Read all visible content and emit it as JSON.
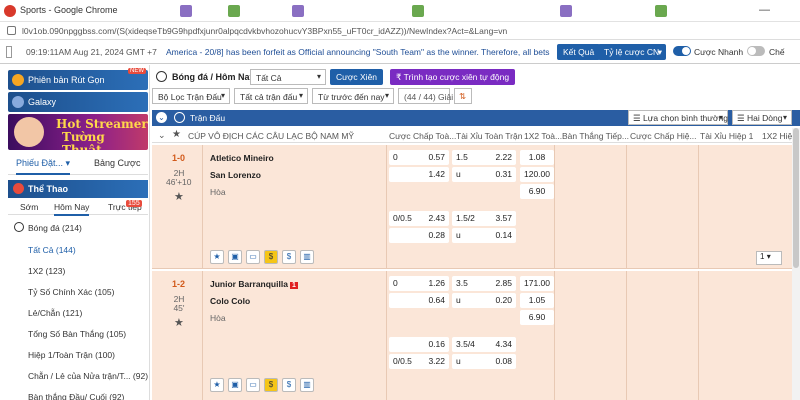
{
  "browser": {
    "title": "Sports - Google Chrome",
    "url": "l0v1ob.090npggbss.com/(S(xideqseTb9G9hpdfxjunr0alpqcdvkbvhozohucvY3BPxn55_uFT0cr_idAZZ))/NewIndex?Act=&Lang=vn",
    "minimize": "—"
  },
  "topbar": {
    "datetime": "09:19:11AM Aug 21, 2024 GMT +7",
    "ticker": "America - 20/8] has been forfeit as Official announcing \"South Team\" as the winner. Therefore, all bets",
    "results_label": "Kết Quả",
    "odds_label": "Tỷ lệ cược CN",
    "quick_bet_label": "Cược Nhanh",
    "che_label": "Chế"
  },
  "sidebar": {
    "banner1": "Phiên bản Rút Gọn",
    "banner1_badge": "NEW",
    "banner2": "Galaxy",
    "streamer_line1": "Hot Streamer",
    "streamer_line2": "Tường Thuật",
    "tab_slip": "Phiếu Đặt...",
    "tab_odds_table": "Bảng Cược",
    "sport_header": "Thể Thao",
    "time_tabs": [
      "Sớm",
      "Hôm Nay",
      "Trực tiếp"
    ],
    "live_badge": "155",
    "items": [
      "Bóng đá (214)",
      "Tất Cả (144)",
      "1X2 (123)",
      "Tỷ Số Chính Xác (105)",
      "Lẻ/Chẵn (121)",
      "Tổng Số Bàn Thắng (105)",
      "Hiệp 1/Toàn Trận (100)",
      "Chẵn / Lẻ của Nửa trận/T... (92)",
      "Bàn thắng Đầu/ Cuối (92)"
    ]
  },
  "main": {
    "sport_label": "Bóng đá / Hôm Nay",
    "filter_all": "Tất Cả",
    "parlay_label": "Cược Xiên",
    "auto_parlay_label": "Trình tạo cược xiên tự động",
    "league_filter": "Bộ Lọc Trận Đấu",
    "all_matches": "Tất cả trận đấu",
    "sort_label": "Từ trước đến nay",
    "count": "(44 / 44) Giải",
    "section_title": "Trận Đấu",
    "view_select": "Lựa chọn bình thường",
    "two_line": "Hai Dòng",
    "columns": [
      "CÚP VÔ ĐỊCH CÁC CÂU LẠC BỘ NAM MỸ",
      "Cược Chấp Toà...",
      "Tài Xỉu Toàn Trận",
      "1X2 Toà...",
      "Bàn Thắng Tiếp...",
      "Cược Chấp Hiệ...",
      "Tài Xỉu Hiệp 1",
      "1X2 Hiệ"
    ],
    "page_select": "1",
    "matches": [
      {
        "score": "1-0",
        "period": "2H",
        "minute": "46'+10",
        "home": "Atletico Mineiro",
        "away": "San Lorenzo",
        "draw": "Hòa",
        "rows": [
          {
            "hdp": "0",
            "hdp_home": "0.57",
            "ou": "1.5",
            "ou_over": "2.22",
            "x12": "1.08"
          },
          {
            "hdp": "",
            "hdp_home": "1.42",
            "ou": "u",
            "ou_over": "0.31",
            "x12": "120.00"
          },
          {
            "hdp": "",
            "hdp_home": "",
            "ou": "",
            "ou_over": "",
            "x12": "6.90"
          },
          {
            "hdp": "0/0.5",
            "hdp_home": "2.43",
            "ou": "1.5/2",
            "ou_over": "3.57",
            "x12": ""
          },
          {
            "hdp": "",
            "hdp_home": "0.28",
            "ou": "u",
            "ou_over": "0.14",
            "x12": ""
          }
        ]
      },
      {
        "score": "1-2",
        "period": "2H",
        "minute": "45'",
        "home": "Junior Barranquilla",
        "home_red_cards": "1",
        "away": "Colo Colo",
        "draw": "Hòa",
        "rows": [
          {
            "hdp": "0",
            "hdp_home": "1.26",
            "ou": "3.5",
            "ou_over": "2.85",
            "x12": "171.00"
          },
          {
            "hdp": "",
            "hdp_home": "0.64",
            "ou": "u",
            "ou_over": "0.20",
            "x12": "1.05"
          },
          {
            "hdp": "",
            "hdp_home": "",
            "ou": "",
            "ou_over": "",
            "x12": "6.90"
          },
          {
            "hdp": "",
            "hdp_home": "0.16",
            "ou": "3.5/4",
            "ou_over": "4.34",
            "x12": ""
          },
          {
            "hdp": "0/0.5",
            "hdp_home": "3.22",
            "ou": "u",
            "ou_over": "0.08",
            "x12": ""
          }
        ]
      }
    ]
  },
  "colors": {
    "brand_blue": "#1f5fa8",
    "section_blue": "#2a5da2",
    "match_bg": "#fbe6d8",
    "score_orange": "#d25a1b",
    "toggle_on": "#1f5fa8"
  }
}
